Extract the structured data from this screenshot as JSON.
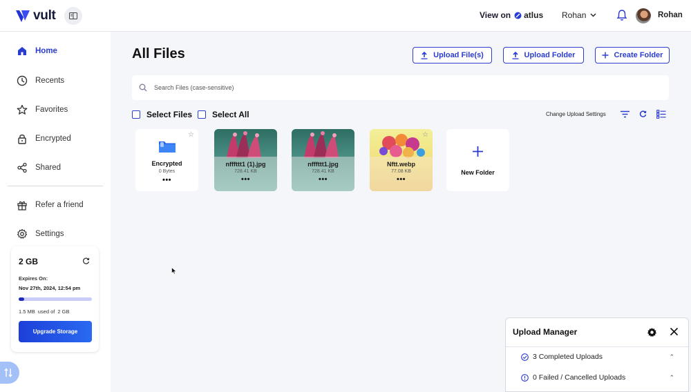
{
  "app": {
    "name": "vult"
  },
  "topbar": {
    "view_on": "View on",
    "atlus": "atlus",
    "user_dropdown": "Rohan",
    "avatar_name": "Rohan"
  },
  "sidebar": {
    "items": [
      {
        "label": "Home",
        "icon": "home-icon"
      },
      {
        "label": "Recents",
        "icon": "clock-icon"
      },
      {
        "label": "Favorites",
        "icon": "star-icon"
      },
      {
        "label": "Encrypted",
        "icon": "lock-icon"
      },
      {
        "label": "Shared",
        "icon": "share-icon"
      },
      {
        "label": "Refer a friend",
        "icon": "gift-icon"
      },
      {
        "label": "Settings",
        "icon": "gear-icon"
      }
    ],
    "storage": {
      "size": "2 GB",
      "expires_label": "Expires On:",
      "expires_value": "Nov 27th, 2024, 12:54 pm",
      "used": "1.5 MB",
      "used_of": "used of",
      "total": "2 GB",
      "usage_fraction": 0.08,
      "upgrade_label": "Upgrade Storage"
    }
  },
  "main": {
    "title": "All Files",
    "buttons": {
      "upload_files": "Upload File(s)",
      "upload_folder": "Upload Folder",
      "create_folder": "Create Folder"
    },
    "search": {
      "placeholder": "Search Files (case-sensitive)"
    },
    "select_files": "Select Files",
    "select_all": "Select All",
    "change_upload_settings": "Change Upload Settings",
    "files": [
      {
        "name": "Encrypted",
        "size": "0 Bytes",
        "type": "folder"
      },
      {
        "name": "nfffttt1 (1).jpg",
        "size": "728.41 KB",
        "type": "image"
      },
      {
        "name": "nfffttt1.jpg",
        "size": "728.41 KB",
        "type": "image"
      },
      {
        "name": "Nftt.webp",
        "size": "77.08 KB",
        "type": "image"
      }
    ],
    "new_folder": "New Folder",
    "more": "•••"
  },
  "upload_manager": {
    "title": "Upload Manager",
    "completed": "3 Completed Uploads",
    "failed": "0 Failed / Cancelled Uploads"
  },
  "colors": {
    "accent": "#2a3bd0",
    "upgrade": "#1d3fd9"
  }
}
